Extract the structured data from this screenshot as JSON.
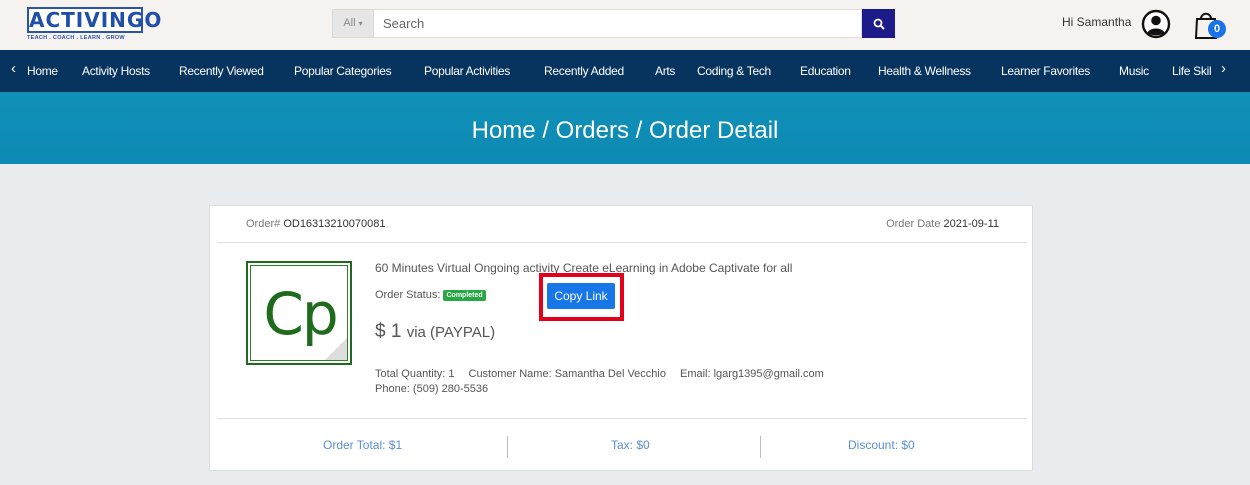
{
  "header": {
    "logo_text": "ACTIVINGO",
    "logo_tagline": "TEACH . COACH . LEARN . GROW",
    "search_category": "All",
    "search_placeholder": "Search",
    "greeting": "Hi Samantha",
    "cart_count": "0"
  },
  "nav": {
    "items": [
      "Home",
      "Activity Hosts",
      "Recently Viewed",
      "Popular Categories",
      "Popular Activities",
      "Recently Added",
      "Arts",
      "Coding & Tech",
      "Education",
      "Health & Wellness",
      "Learner Favorites",
      "Music",
      "Life Skil"
    ]
  },
  "banner": {
    "title": "Home / Orders / Order Detail"
  },
  "order": {
    "number_label": "Order#",
    "number": "OD16313210070081",
    "date_label": "Order Date",
    "date": "2021-09-11",
    "product_logo_text": "Cp",
    "product_title": "60 Minutes Virtual Ongoing activity Create eLearning in Adobe Captivate for all",
    "status_label": "Order Status:",
    "status": "Completed",
    "copy_link_label": "Copy Link",
    "price": "$ 1",
    "payment": "via (PAYPAL)",
    "total_quantity": "Total Quantity: 1",
    "customer_name": "Customer Name: Samantha Del Vecchio",
    "email": "Email: lgarg1395@gmail.com",
    "phone": "Phone: (509) 280-5536",
    "order_total": "Order Total: $1",
    "tax": "Tax: $0",
    "discount": "Discount: $0"
  },
  "colors": {
    "nav_bg": "#07345f",
    "banner_bg": "#0c8ab3",
    "search_button": "#1d1a8a",
    "accent_blue": "#1877e8",
    "status_green": "#28a745",
    "highlight_red": "#e3001a"
  },
  "icons": {
    "search": "search-icon",
    "user": "user-avatar-icon",
    "cart": "shopping-bag-icon",
    "nav_prev": "chevron-left-icon",
    "nav_next": "chevron-right-icon"
  }
}
